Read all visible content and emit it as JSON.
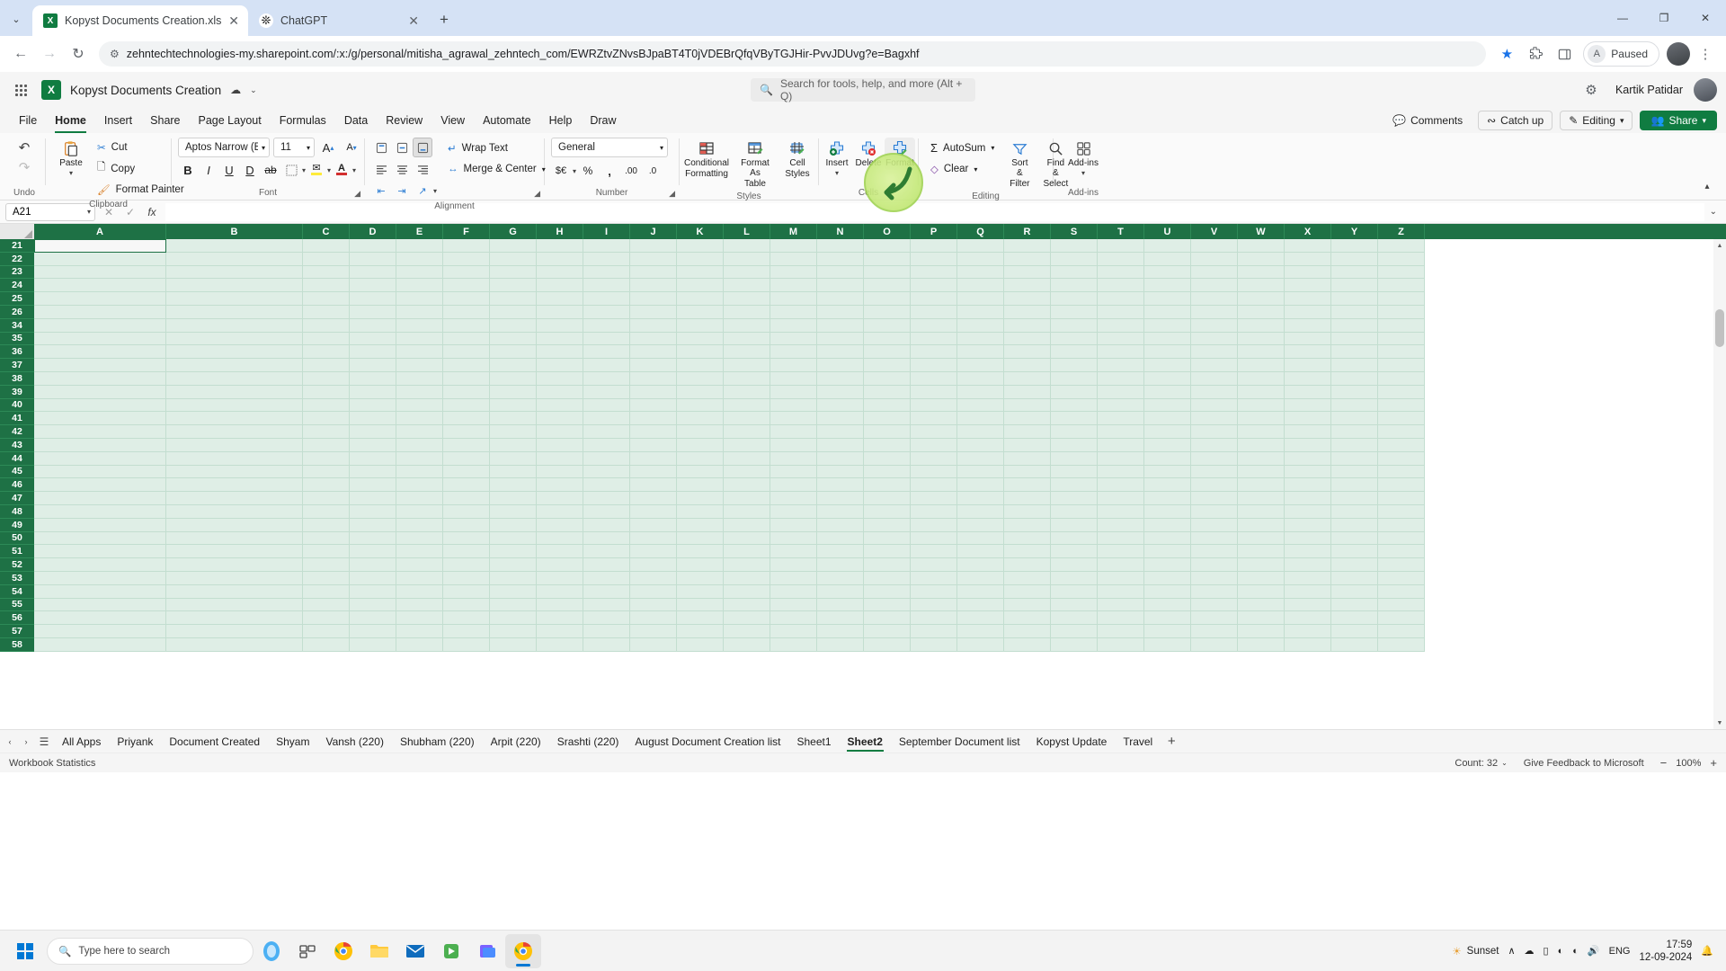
{
  "browser": {
    "tabs": [
      {
        "title": "Kopyst Documents Creation.xlsx",
        "favicon": "excel-icon",
        "active": true
      },
      {
        "title": "ChatGPT",
        "favicon": "chatgpt-icon",
        "active": false
      }
    ],
    "new_tab_label": "+",
    "tab_close_label": "✕",
    "tab_list_label": "⌄",
    "nav": {
      "back": "←",
      "forward": "→",
      "reload": "↻"
    },
    "omnibox": {
      "url": "zehntechtechnologies-my.sharepoint.com/:x:/g/personal/mitisha_agrawal_zehntech_com/EWRZtvZNvsBJpaBT4T0jVDEBrQfqVByTGJHir-PvvJDUvg?e=Bagxhf",
      "site_settings_icon": "tune-icon"
    },
    "toolbar": {
      "bookmark_star": "★",
      "extensions_icon": "puzzle-icon",
      "side_panel_icon": "panel-icon",
      "menu_icon": "⋮",
      "paused_label": "Paused",
      "paused_avatar_letter": "A"
    },
    "window_controls": {
      "minimize": "—",
      "maximize": "❐",
      "close": "✕"
    }
  },
  "excel": {
    "header": {
      "waffle_label": "app-launcher",
      "doc_title": "Kopyst Documents Creation",
      "autosave_icon": "cloud-saved-icon",
      "title_chevron": "⌄",
      "search_placeholder": "Search for tools, help, and more (Alt + Q)",
      "settings_icon": "gear-icon",
      "user_name": "Kartik Patidar"
    },
    "ribbon_tabs": [
      {
        "label": "File",
        "active": false
      },
      {
        "label": "Home",
        "active": true
      },
      {
        "label": "Insert",
        "active": false
      },
      {
        "label": "Share",
        "active": false
      },
      {
        "label": "Page Layout",
        "active": false
      },
      {
        "label": "Formulas",
        "active": false
      },
      {
        "label": "Data",
        "active": false
      },
      {
        "label": "Review",
        "active": false
      },
      {
        "label": "View",
        "active": false
      },
      {
        "label": "Automate",
        "active": false
      },
      {
        "label": "Help",
        "active": false
      },
      {
        "label": "Draw",
        "active": false
      }
    ],
    "ribbon_right": {
      "comments": "Comments",
      "catch_up": "Catch up",
      "editing": "Editing",
      "share": "Share"
    },
    "ribbon": {
      "undo_group": {
        "label": "Undo",
        "undo": "↶",
        "redo": "↷"
      },
      "clipboard": {
        "label": "Clipboard",
        "paste": "Paste",
        "cut": "Cut",
        "copy": "Copy",
        "format_painter": "Format Painter"
      },
      "font": {
        "label": "Font",
        "font_name": "Aptos Narrow (Bo...",
        "font_size": "11",
        "grow_font": "A",
        "shrink_font": "A",
        "bold": "B",
        "italic": "I",
        "underline": "U",
        "double_underline": "D",
        "strikethrough": "ab",
        "borders": "borders-icon",
        "fill_color": "fill-color-icon",
        "font_color": "A"
      },
      "alignment": {
        "label": "Alignment",
        "top_align": "top-align-icon",
        "middle_align": "middle-align-icon",
        "bottom_align": "bottom-align-icon",
        "align_left": "align-left-icon",
        "align_center": "align-center-icon",
        "align_right": "align-right-icon",
        "decrease_indent": "decrease-indent-icon",
        "increase_indent": "increase-indent-icon",
        "orientation": "orientation-icon",
        "wrap_text": "Wrap Text",
        "merge_center": "Merge & Center"
      },
      "number": {
        "label": "Number",
        "format": "General",
        "currency": "$€",
        "percent": "%",
        "comma": ",",
        "increase_decimal": "increase-decimal-icon",
        "decrease_decimal": "decrease-decimal-icon"
      },
      "styles": {
        "label": "Styles",
        "conditional_formatting": "Conditional Formatting",
        "conditional_l1": "Conditional",
        "conditional_l2": "Formatting",
        "format_as_table": "Format As Table",
        "format_l1": "Format As",
        "format_l2": "Table",
        "cell_styles": "Cell Styles",
        "cell_l1": "Cell",
        "cell_l2": "Styles"
      },
      "cells": {
        "label": "Cells",
        "insert": "Insert",
        "delete": "Delete",
        "format": "Format"
      },
      "editing": {
        "label": "Editing",
        "autosum": "AutoSum",
        "clear": "Clear",
        "sort_filter_l1": "Sort &",
        "sort_filter_l2": "Filter",
        "find_select_l1": "Find &",
        "find_select_l2": "Select"
      },
      "addins": {
        "label": "Add-ins",
        "button": "Add-ins"
      }
    },
    "formula_bar": {
      "name_box_value": "A21",
      "cancel_icon": "✕",
      "enter_icon": "✓",
      "function_icon": "fx",
      "formula_value": "",
      "expand_icon": "⌄"
    },
    "grid": {
      "columns": [
        "A",
        "B",
        "C",
        "D",
        "E",
        "F",
        "G",
        "H",
        "I",
        "J",
        "K",
        "L",
        "M",
        "N",
        "O",
        "P",
        "Q",
        "R",
        "S",
        "T",
        "U",
        "V",
        "W",
        "X",
        "Y",
        "Z"
      ],
      "rows": [
        21,
        22,
        23,
        24,
        25,
        26,
        34,
        35,
        36,
        37,
        38,
        39,
        40,
        41,
        42,
        43,
        44,
        45,
        46,
        47,
        48,
        49,
        50,
        51,
        52,
        53,
        54,
        55,
        56,
        57,
        58
      ],
      "selected_cell": "A21"
    },
    "sheet_tabs": [
      {
        "label": "All Apps",
        "active": false
      },
      {
        "label": "Priyank",
        "active": false
      },
      {
        "label": "Document Created",
        "active": false
      },
      {
        "label": "Shyam",
        "active": false
      },
      {
        "label": "Vansh (220)",
        "active": false
      },
      {
        "label": "Shubham (220)",
        "active": false
      },
      {
        "label": "Arpit (220)",
        "active": false
      },
      {
        "label": "Srashti (220)",
        "active": false
      },
      {
        "label": "August Document Creation list",
        "active": false
      },
      {
        "label": "Sheet1",
        "active": false
      },
      {
        "label": "Sheet2",
        "active": true
      },
      {
        "label": "September Document list",
        "active": false
      },
      {
        "label": "Kopyst Update",
        "active": false
      },
      {
        "label": "Travel",
        "active": false
      }
    ],
    "sheet_nav": {
      "prev": "‹",
      "next": "›",
      "menu": "☰",
      "add": "+"
    },
    "status_bar": {
      "workbook_statistics": "Workbook Statistics",
      "count": "Count: 32",
      "count_chevron": "⌄",
      "feedback": "Give Feedback to Microsoft",
      "zoom_out": "−",
      "zoom_level": "100%",
      "zoom_in": "+"
    }
  },
  "taskbar": {
    "start_label": "start-button",
    "search_placeholder": "Type here to search",
    "apps": [
      "task-view-icon",
      "chrome-icon",
      "file-explorer-icon",
      "mail-icon",
      "store-icon",
      "app-icon",
      "chrome-active-icon"
    ],
    "tray": {
      "weather": "Sunset",
      "show_hidden": "∧",
      "language": "ENG",
      "time": "17:59",
      "date": "12-09-2024",
      "notification_icon": "bell-icon"
    }
  },
  "colors": {
    "excel_green": "#107c41",
    "header_green": "#1e7145",
    "cell_fill": "#dfeee6",
    "highlight": "#c6ea7a",
    "chrome_tab_bg": "#d5e2f5"
  }
}
